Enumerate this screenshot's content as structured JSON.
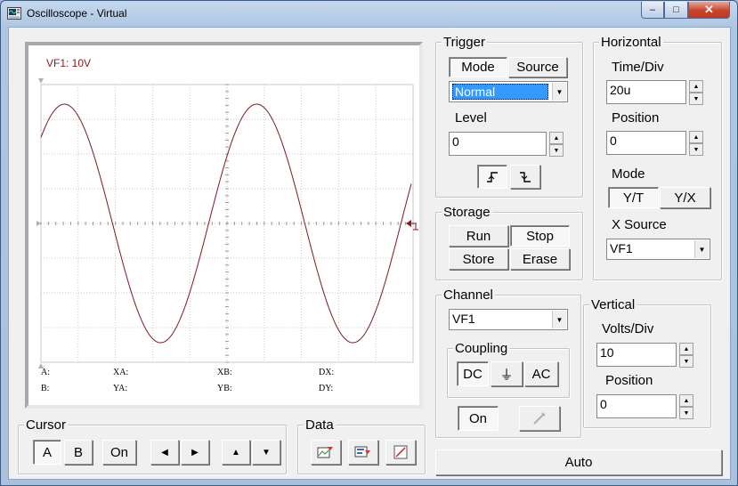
{
  "window": {
    "title": "Oscilloscope - Virtual",
    "min": "–",
    "max": "□",
    "close": "✕"
  },
  "colors": {
    "trace": "#7b1a1f",
    "grid": "#c8c8c8",
    "channel_label": "#8b1a1a"
  },
  "display": {
    "channel_label": "VF1: 10V",
    "readouts": {
      "a": "A:",
      "b": "B:",
      "xa": "XA:",
      "ya": "YA:",
      "xb": "XB:",
      "yb": "YB:",
      "dx": "DX:",
      "dy": "DY:"
    }
  },
  "trigger": {
    "title": "Trigger",
    "mode_tab": "Mode",
    "source_tab": "Source",
    "mode_value": "Normal",
    "level_label": "Level",
    "level_value": "0",
    "rising_icon": "rising-edge-icon",
    "falling_icon": "falling-edge-icon"
  },
  "storage": {
    "title": "Storage",
    "run": "Run",
    "stop": "Stop",
    "store": "Store",
    "erase": "Erase"
  },
  "horizontal": {
    "title": "Horizontal",
    "time_div_label": "Time/Div",
    "time_div_value": "20u",
    "position_label": "Position",
    "position_value": "0",
    "mode_label": "Mode",
    "yt": "Y/T",
    "yx": "Y/X",
    "xsource_label": "X Source",
    "xsource_value": "VF1"
  },
  "channel": {
    "title": "Channel",
    "value": "VF1",
    "coupling_title": "Coupling",
    "dc": "DC",
    "gnd": "⏚",
    "ac": "AC",
    "on": "On",
    "probe_icon": "probe-icon"
  },
  "vertical": {
    "title": "Vertical",
    "volts_div_label": "Volts/Div",
    "volts_div_value": "10",
    "position_label": "Position",
    "position_value": "0"
  },
  "cursor": {
    "title": "Cursor",
    "a": "A",
    "b": "B",
    "on": "On",
    "left_icon": "arrow-left-icon",
    "right_icon": "arrow-right-icon",
    "up_icon": "arrow-up-icon",
    "down_icon": "arrow-down-icon"
  },
  "data": {
    "title": "Data",
    "export_icon": "export-image-icon",
    "send_icon": "send-data-icon",
    "clear_icon": "clear-icon"
  },
  "auto": "Auto"
}
